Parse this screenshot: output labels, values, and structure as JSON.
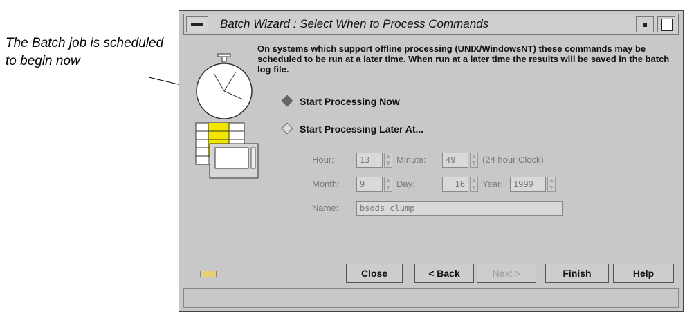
{
  "callout": {
    "text": "The Batch job is scheduled to begin now"
  },
  "window": {
    "title": "Batch Wizard : Select When to Process Commands",
    "description": "On systems which support offline processing (UNIX/WindowsNT) these commands may be scheduled to be run at a later time. When run at a later time the results will be saved in the batch log file.",
    "options": [
      {
        "label": "Start Processing Now",
        "selected": true
      },
      {
        "label": "Start Processing Later At...",
        "selected": false
      }
    ],
    "fields": {
      "hour_label": "Hour:",
      "hour": "13",
      "minute_label": "Minute:",
      "minute": "49",
      "clock_note": "(24 hour Clock)",
      "month_label": "Month:",
      "month": "9",
      "day_label": "Day:",
      "day": "16",
      "year_label": "Year:",
      "year": "1999",
      "name_label": "Name:",
      "name": "bsods clump"
    },
    "buttons": {
      "close": "Close",
      "back": "< Back",
      "next": "Next >",
      "finish": "Finish",
      "help": "Help"
    }
  }
}
